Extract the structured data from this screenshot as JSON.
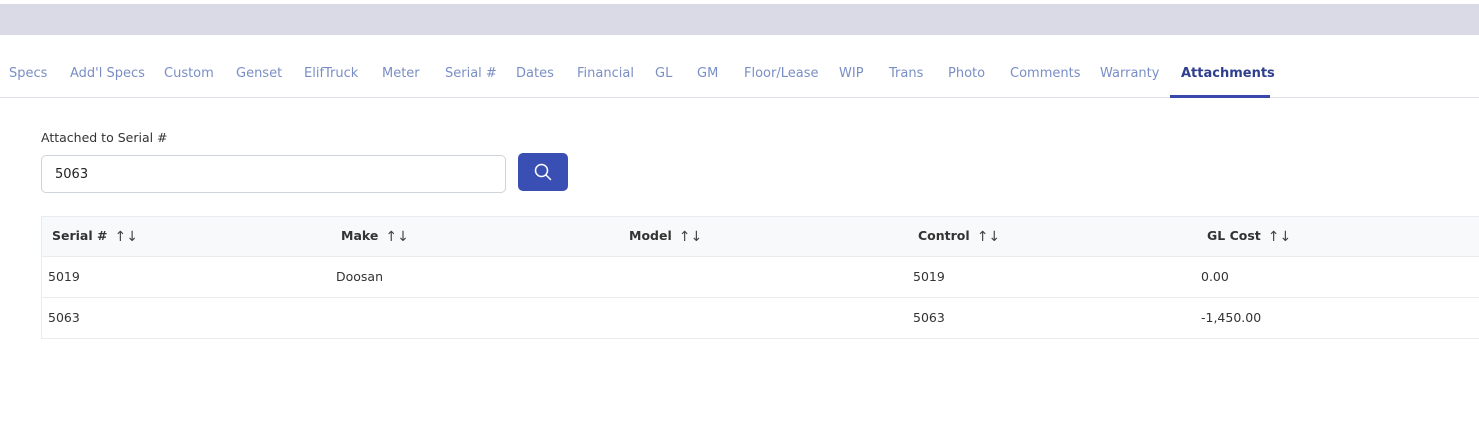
{
  "tabs": [
    {
      "label": "Specs",
      "active": false
    },
    {
      "label": "Add'l Specs",
      "active": false
    },
    {
      "label": "Custom",
      "active": false
    },
    {
      "label": "Genset",
      "active": false
    },
    {
      "label": "ElifTruck",
      "active": false
    },
    {
      "label": "Meter",
      "active": false
    },
    {
      "label": "Serial #",
      "active": false
    },
    {
      "label": "Dates",
      "active": false
    },
    {
      "label": "Financial",
      "active": false
    },
    {
      "label": "GL",
      "active": false
    },
    {
      "label": "GM",
      "active": false
    },
    {
      "label": "Floor/Lease",
      "active": false
    },
    {
      "label": "WIP",
      "active": false
    },
    {
      "label": "Trans",
      "active": false
    },
    {
      "label": "Photo",
      "active": false
    },
    {
      "label": "Comments",
      "active": false
    },
    {
      "label": "Warranty",
      "active": false
    },
    {
      "label": "Attachments",
      "active": true
    }
  ],
  "search": {
    "label": "Attached to Serial #",
    "value": "5063",
    "button_icon": "search-icon"
  },
  "table": {
    "columns": [
      "Serial #",
      "Make",
      "Model",
      "Control",
      "GL Cost"
    ],
    "sort_icon": "↑↓",
    "rows": [
      [
        "5019",
        "Doosan",
        "",
        "5019",
        "0.00"
      ],
      [
        "5063",
        "",
        "",
        "5063",
        "-1,450.00"
      ]
    ]
  },
  "colors": {
    "accent": "#3a4fb4",
    "tab_text": "#7a8ec6",
    "tab_active_text": "#2f3f8e",
    "top_band": "#dadae6"
  }
}
